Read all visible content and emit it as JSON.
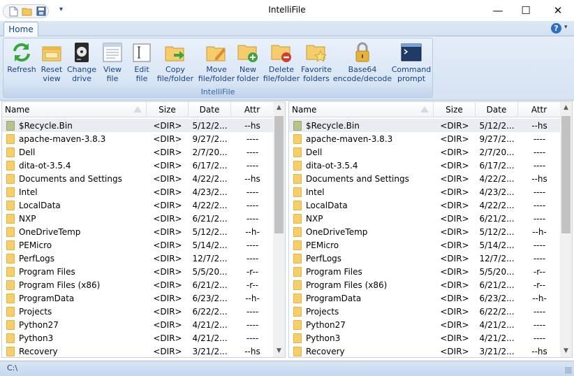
{
  "app": {
    "title": "IntelliFile"
  },
  "qat": {
    "icons": [
      "new-document-icon",
      "open-folder-icon",
      "save-icon"
    ]
  },
  "window_controls": {
    "minimize": "—",
    "maximize": "☐",
    "close": "✕"
  },
  "ribbon": {
    "tabs": [
      {
        "label": "Home"
      }
    ],
    "group_label": "IntelliFile",
    "buttons": [
      {
        "label": "Refresh",
        "icon": "refresh-icon"
      },
      {
        "label": "Reset\nview",
        "icon": "reset-view-icon"
      },
      {
        "label": "Change\ndrive",
        "icon": "drive-icon"
      },
      {
        "label": "View\nfile",
        "icon": "view-file-icon"
      },
      {
        "label": "Edit\nfile",
        "icon": "edit-file-icon"
      },
      {
        "label": "Copy\nfile/folder",
        "icon": "copy-folder-icon"
      },
      {
        "label": "Move\nfile/folder",
        "icon": "move-folder-icon"
      },
      {
        "label": "New\nfolder",
        "icon": "new-folder-icon"
      },
      {
        "label": "Delete\nfile/folder",
        "icon": "delete-folder-icon"
      },
      {
        "label": "Favorite\nfolders",
        "icon": "favorite-folders-icon"
      },
      {
        "label": "Base64\nencode/decode",
        "icon": "lock-icon"
      },
      {
        "label": "Command\nprompt",
        "icon": "terminal-icon"
      }
    ]
  },
  "columns": {
    "name": "Name",
    "size": "Size",
    "date": "Date",
    "attr": "Attr"
  },
  "left_pane": {
    "rows": [
      {
        "name": "$Recycle.Bin",
        "size": "<DIR>",
        "date": "5/12/2...",
        "attr": "--hs"
      },
      {
        "name": "apache-maven-3.8.3",
        "size": "<DIR>",
        "date": "9/27/2...",
        "attr": "----"
      },
      {
        "name": "Dell",
        "size": "<DIR>",
        "date": "2/7/20...",
        "attr": "----"
      },
      {
        "name": "dita-ot-3.5.4",
        "size": "<DIR>",
        "date": "6/17/2...",
        "attr": "----"
      },
      {
        "name": "Documents and Settings",
        "size": "<DIR>",
        "date": "4/22/2...",
        "attr": "--hs"
      },
      {
        "name": "Intel",
        "size": "<DIR>",
        "date": "4/23/2...",
        "attr": "----"
      },
      {
        "name": "LocalData",
        "size": "<DIR>",
        "date": "4/22/2...",
        "attr": "----"
      },
      {
        "name": "NXP",
        "size": "<DIR>",
        "date": "6/21/2...",
        "attr": "----"
      },
      {
        "name": "OneDriveTemp",
        "size": "<DIR>",
        "date": "5/12/2...",
        "attr": "--h-"
      },
      {
        "name": "PEMicro",
        "size": "<DIR>",
        "date": "5/14/2...",
        "attr": "----"
      },
      {
        "name": "PerfLogs",
        "size": "<DIR>",
        "date": "12/7/2...",
        "attr": "----"
      },
      {
        "name": "Program Files",
        "size": "<DIR>",
        "date": "5/5/20...",
        "attr": "-r--"
      },
      {
        "name": "Program Files (x86)",
        "size": "<DIR>",
        "date": "6/21/2...",
        "attr": "-r--"
      },
      {
        "name": "ProgramData",
        "size": "<DIR>",
        "date": "6/23/2...",
        "attr": "--h-"
      },
      {
        "name": "Projects",
        "size": "<DIR>",
        "date": "6/22/2...",
        "attr": "----"
      },
      {
        "name": "Python27",
        "size": "<DIR>",
        "date": "4/21/2...",
        "attr": "----"
      },
      {
        "name": "Python3",
        "size": "<DIR>",
        "date": "4/21/2...",
        "attr": "----"
      },
      {
        "name": "Recovery",
        "size": "<DIR>",
        "date": "3/21/2...",
        "attr": "--hs"
      }
    ]
  },
  "right_pane": {
    "rows": [
      {
        "name": "$Recycle.Bin",
        "size": "<DIR>",
        "date": "5/12/2...",
        "attr": "--hs"
      },
      {
        "name": "apache-maven-3.8.3",
        "size": "<DIR>",
        "date": "9/27/2...",
        "attr": "----"
      },
      {
        "name": "Dell",
        "size": "<DIR>",
        "date": "2/7/20...",
        "attr": "----"
      },
      {
        "name": "dita-ot-3.5.4",
        "size": "<DIR>",
        "date": "6/17/2...",
        "attr": "----"
      },
      {
        "name": "Documents and Settings",
        "size": "<DIR>",
        "date": "4/22/2...",
        "attr": "--hs"
      },
      {
        "name": "Intel",
        "size": "<DIR>",
        "date": "4/23/2...",
        "attr": "----"
      },
      {
        "name": "LocalData",
        "size": "<DIR>",
        "date": "4/22/2...",
        "attr": "----"
      },
      {
        "name": "NXP",
        "size": "<DIR>",
        "date": "6/21/2...",
        "attr": "----"
      },
      {
        "name": "OneDriveTemp",
        "size": "<DIR>",
        "date": "5/12/2...",
        "attr": "--h-"
      },
      {
        "name": "PEMicro",
        "size": "<DIR>",
        "date": "5/14/2...",
        "attr": "----"
      },
      {
        "name": "PerfLogs",
        "size": "<DIR>",
        "date": "12/7/2...",
        "attr": "----"
      },
      {
        "name": "Program Files",
        "size": "<DIR>",
        "date": "5/5/20...",
        "attr": "-r--"
      },
      {
        "name": "Program Files (x86)",
        "size": "<DIR>",
        "date": "6/21/2...",
        "attr": "-r--"
      },
      {
        "name": "ProgramData",
        "size": "<DIR>",
        "date": "6/23/2...",
        "attr": "--h-"
      },
      {
        "name": "Projects",
        "size": "<DIR>",
        "date": "6/22/2...",
        "attr": "----"
      },
      {
        "name": "Python27",
        "size": "<DIR>",
        "date": "4/21/2...",
        "attr": "----"
      },
      {
        "name": "Python3",
        "size": "<DIR>",
        "date": "4/21/2...",
        "attr": "----"
      },
      {
        "name": "Recovery",
        "size": "<DIR>",
        "date": "3/21/2...",
        "attr": "--hs"
      }
    ]
  },
  "status": {
    "path": "C:\\"
  }
}
